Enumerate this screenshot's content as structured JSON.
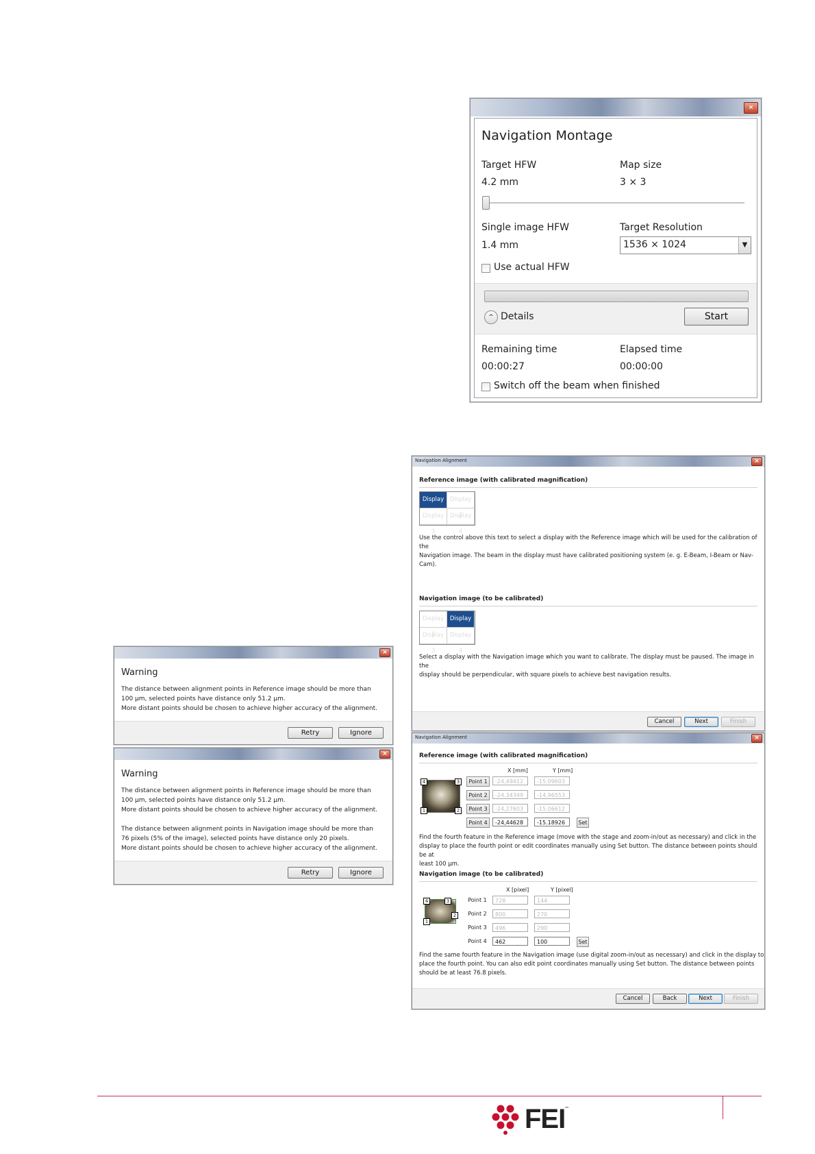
{
  "nav_montage": {
    "title": "Navigation Montage",
    "close_icon": "close-icon",
    "target_hfw_label": "Target HFW",
    "target_hfw_value": "4.2 mm",
    "map_size_label": "Map size",
    "map_size_value": "3 × 3",
    "single_hfw_label": "Single image HFW",
    "single_hfw_value": "1.4 mm",
    "target_res_label": "Target Resolution",
    "target_res_value": "1536 × 1024",
    "use_actual_label": "Use actual HFW",
    "details_label": "Details",
    "start_label": "Start",
    "remaining_label": "Remaining time",
    "remaining_value": "00:00:27",
    "elapsed_label": "Elapsed time",
    "elapsed_value": "00:00:00",
    "switch_off_label": "Switch off the beam when finished"
  },
  "nav_align_1": {
    "title": "Navigation Alignment",
    "ref_title": "Reference image (with calibrated magnification)",
    "ref_displays": [
      "Display 1",
      "Display 2",
      "Display 3",
      "Display 4"
    ],
    "ref_text_1": "Use the control above this text to select a display with the Reference image which will be used for the calibration of the",
    "ref_text_2": "Navigation image. The beam in the display must have calibrated positioning system (e. g. E-Beam, I-Beam or Nav-Cam).",
    "nav_title": "Navigation image (to be calibrated)",
    "nav_displays": [
      "Display 1",
      "Display 2",
      "Display 3",
      "Display 4"
    ],
    "nav_text_1": "Select a display with the Navigation image which you want to calibrate. The display must be paused. The image in the",
    "nav_text_2": "display should be perpendicular, with square pixels to achieve best navigation results.",
    "cancel": "Cancel",
    "next": "Next",
    "finish": "Finish"
  },
  "warning_1": {
    "title": "Warning",
    "line1": "The distance between alignment points in Reference image should be more than",
    "line2": "100 µm, selected points have distance only 51.2 µm.",
    "line3": "More distant points should be chosen to achieve higher accuracy of the alignment.",
    "retry": "Retry",
    "ignore": "Ignore"
  },
  "warning_2": {
    "title": "Warning",
    "line1": "The distance between alignment points in Reference image should be more than",
    "line2": "100 µm, selected points have distance only 51.2 µm.",
    "line3": "More distant points should be chosen to achieve higher accuracy of the alignment.",
    "line4": "The distance between alignment points in Navigation image should be more than",
    "line5": "76 pixels (5% of the image), selected points have distance only 20 pixels.",
    "line6": "More distant points should be chosen to achieve higher accuracy of the alignment.",
    "retry": "Retry",
    "ignore": "Ignore"
  },
  "nav_align_2": {
    "title": "Navigation Alignment",
    "ref_title": "Reference image (with calibrated magnification)",
    "ref_x_header": "X [mm]",
    "ref_y_header": "Y [mm]",
    "ref_points": [
      {
        "label": "Point 1",
        "x": "-24,49412",
        "y": "-15.09603"
      },
      {
        "label": "Point 2",
        "x": "-24,34349",
        "y": "-14,96553"
      },
      {
        "label": "Point 3",
        "x": "-24,27603",
        "y": "-15.06612"
      },
      {
        "label": "Point 4",
        "x": "-24,44628",
        "y": "-15.18926"
      }
    ],
    "set": "Set",
    "ref_text_1": "Find the fourth feature in the Reference image (move with the stage and zoom-in/out as necessary) and click in the",
    "ref_text_2": "display to place the fourth point or edit coordinates manually using Set button. The distance between points should be at",
    "ref_text_3": "least 100 µm.",
    "nav_title": "Navigation image (to be calibrated)",
    "nav_x_header": "X [pixel]",
    "nav_y_header": "Y [pixel]",
    "nav_points": [
      {
        "label": "Point 1",
        "x": "728",
        "y": "144"
      },
      {
        "label": "Point 2",
        "x": "800",
        "y": "270"
      },
      {
        "label": "Point 3",
        "x": "496",
        "y": "290"
      },
      {
        "label": "Point 4",
        "x": "462",
        "y": "100"
      }
    ],
    "nav_text_1": "Find the same fourth feature in the Navigation image (use digital zoom-in/out as necessary) and click in the display to",
    "nav_text_2": "place the fourth point. You can also edit point coordinates manually using Set button. The distance between points",
    "nav_text_3": "should be at least 76.8 pixels.",
    "marker_labels": [
      "4",
      "3",
      "1",
      "2"
    ],
    "cancel": "Cancel",
    "back": "Back",
    "next": "Next",
    "finish": "Finish"
  },
  "footer": {
    "logo_text": "FEI",
    "logo_tm": "™",
    "line_color": "#c0306a",
    "logo_color": "#c8102e"
  }
}
